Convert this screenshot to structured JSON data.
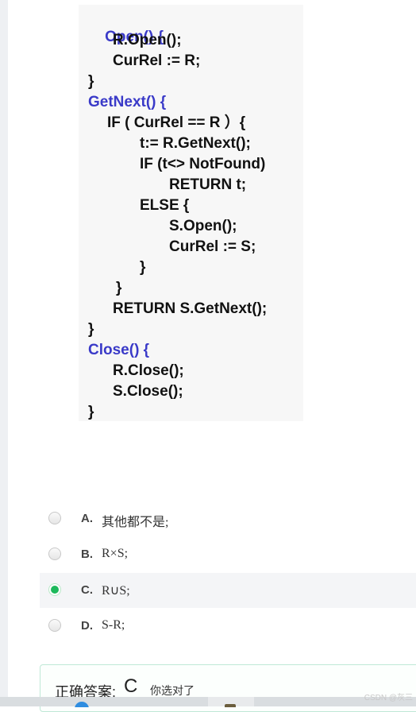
{
  "code": {
    "lines": [
      "Open() {",
      "R.Open();",
      "CurRel := R;",
      "}",
      "GetNext() {",
      "IF ( CurRel == R ）{",
      "t:= R.GetNext();",
      "IF (t<> NotFound)",
      "RETURN t;",
      "ELSE {",
      "S.Open();",
      "CurRel := S;",
      "}",
      "}",
      "RETURN S.GetNext();",
      "}",
      "Close() {",
      "R.Close();",
      "S.Close();",
      "}"
    ],
    "keyword_color": "#3a3ac8"
  },
  "options": [
    {
      "letter": "A.",
      "text": "其他都不是;",
      "selected": false
    },
    {
      "letter": "B.",
      "text": "R×S;",
      "selected": false
    },
    {
      "letter": "C.",
      "text": "R∪S;",
      "selected": true
    },
    {
      "letter": "D.",
      "text": "S-R;",
      "selected": false
    }
  ],
  "answer": {
    "label": "正确答案:",
    "value": "C",
    "note": "你选对了"
  },
  "watermark": "CSDN @灰三",
  "colors": {
    "selected_radio": "#1cb95b",
    "answer_border": "#bfe8d6"
  }
}
